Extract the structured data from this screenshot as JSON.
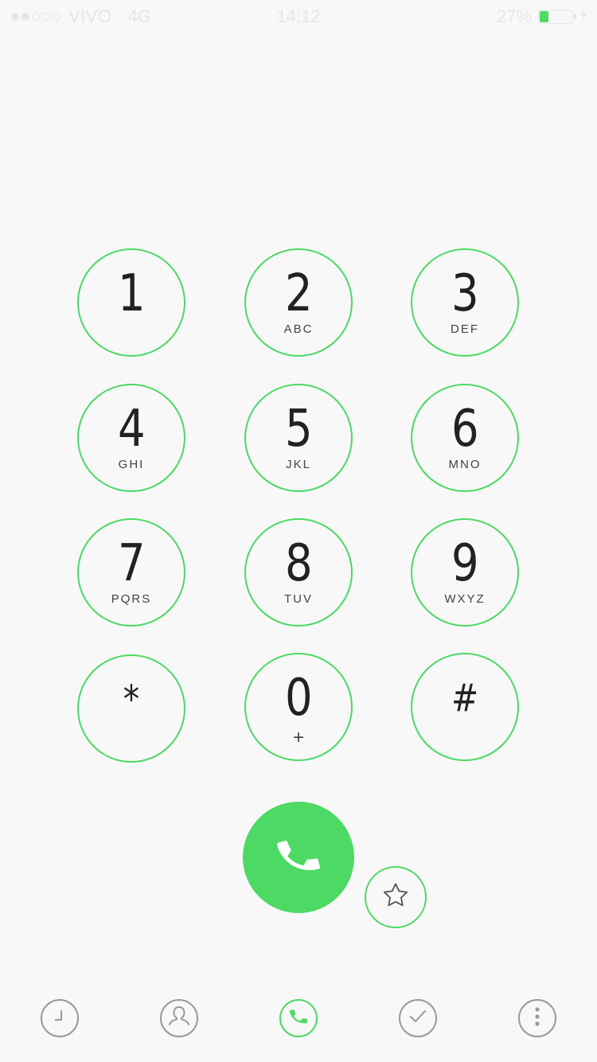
{
  "status_bar": {
    "carrier": "VIVO",
    "network": "4G",
    "time": "14:12",
    "battery_percent": "27%",
    "battery_level": 0.27,
    "signal_bars_filled": 2,
    "signal_bars_total": 5
  },
  "keypad": [
    {
      "digit": "1",
      "letters": ""
    },
    {
      "digit": "2",
      "letters": "ABC"
    },
    {
      "digit": "3",
      "letters": "DEF"
    },
    {
      "digit": "4",
      "letters": "GHI"
    },
    {
      "digit": "5",
      "letters": "JKL"
    },
    {
      "digit": "6",
      "letters": "MNO"
    },
    {
      "digit": "7",
      "letters": "PQRS"
    },
    {
      "digit": "8",
      "letters": "TUV"
    },
    {
      "digit": "9",
      "letters": "WXYZ"
    },
    {
      "digit": "*",
      "letters": ""
    },
    {
      "digit": "0",
      "letters": "+"
    },
    {
      "digit": "#",
      "letters": ""
    }
  ],
  "actions": {
    "call_icon": "phone-icon",
    "favorite_icon": "star-icon"
  },
  "tab_bar": {
    "active": "dialer",
    "items": [
      {
        "id": "recents",
        "icon": "clock-icon"
      },
      {
        "id": "contacts",
        "icon": "person-icon"
      },
      {
        "id": "dialer",
        "icon": "phone-icon"
      },
      {
        "id": "tasks",
        "icon": "check-icon"
      },
      {
        "id": "more",
        "icon": "more-icon"
      }
    ]
  },
  "colors": {
    "accent": "#4cd964",
    "background": "#f8f8f8",
    "inactive_icon": "#999999"
  }
}
